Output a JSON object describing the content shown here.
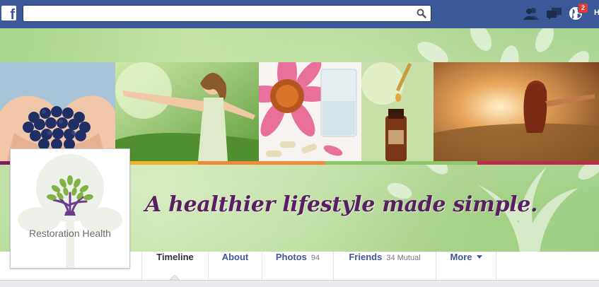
{
  "topbar": {
    "logo": "f",
    "search_placeholder": "",
    "friend_requests_icon": "friends-icon",
    "messages_icon": "messages-icon",
    "notifications_icon": "globe-icon",
    "notifications_count": "2",
    "home_label": "H",
    "colors": {
      "bar": "#3b5998",
      "badge": "#e53935"
    }
  },
  "cover": {
    "tagline": "A healthier lifestyle made simple.",
    "photos": [
      "blueberries",
      "woman-in-meadow",
      "echinacea-flower-and-capsules",
      "dropper-bottle",
      "woman-at-sunset"
    ],
    "colors": {
      "tagline": "#5a1e63",
      "strip": [
        "#7b1e5a",
        "#f0b12b",
        "#f08a3c",
        "#8fc56b",
        "#c02a4a"
      ]
    }
  },
  "profile": {
    "name": "Restoration Health"
  },
  "nav": {
    "tabs": [
      {
        "label": "Timeline",
        "count": ""
      },
      {
        "label": "About",
        "count": ""
      },
      {
        "label": "Photos",
        "count": "94"
      },
      {
        "label": "Friends",
        "count": "34 Mutual"
      },
      {
        "label": "More",
        "count": ""
      }
    ]
  }
}
